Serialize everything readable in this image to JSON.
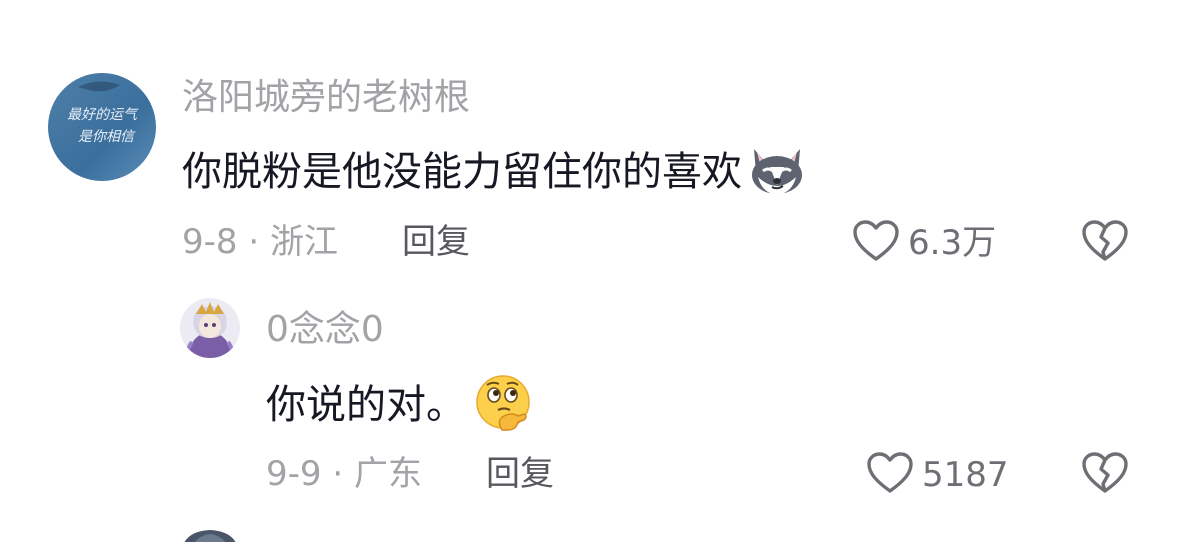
{
  "comments": [
    {
      "username": "洛阳城旁的老树根",
      "avatar_text_line1": "最好的运气",
      "avatar_text_line2": "是你相信",
      "content": "你脱粉是他没能力留住你的喜欢",
      "emoji": "husky-smirk-emoji",
      "date_location": "9-8 · 浙江",
      "reply_label": "回复",
      "like_count": "6.3万"
    },
    {
      "username": "0念念0",
      "content": "你说的对。",
      "emoji": "thinking-face-emoji",
      "date_location": "9-9 · 广东",
      "reply_label": "回复",
      "like_count": "5187"
    }
  ],
  "icons": {
    "like": "heart-outline-icon",
    "dislike": "broken-heart-icon"
  },
  "colors": {
    "username": "#a2a2a7",
    "content": "#161823",
    "meta": "#a2a2a7",
    "reply": "#57575e",
    "icon": "#6e6e75"
  }
}
